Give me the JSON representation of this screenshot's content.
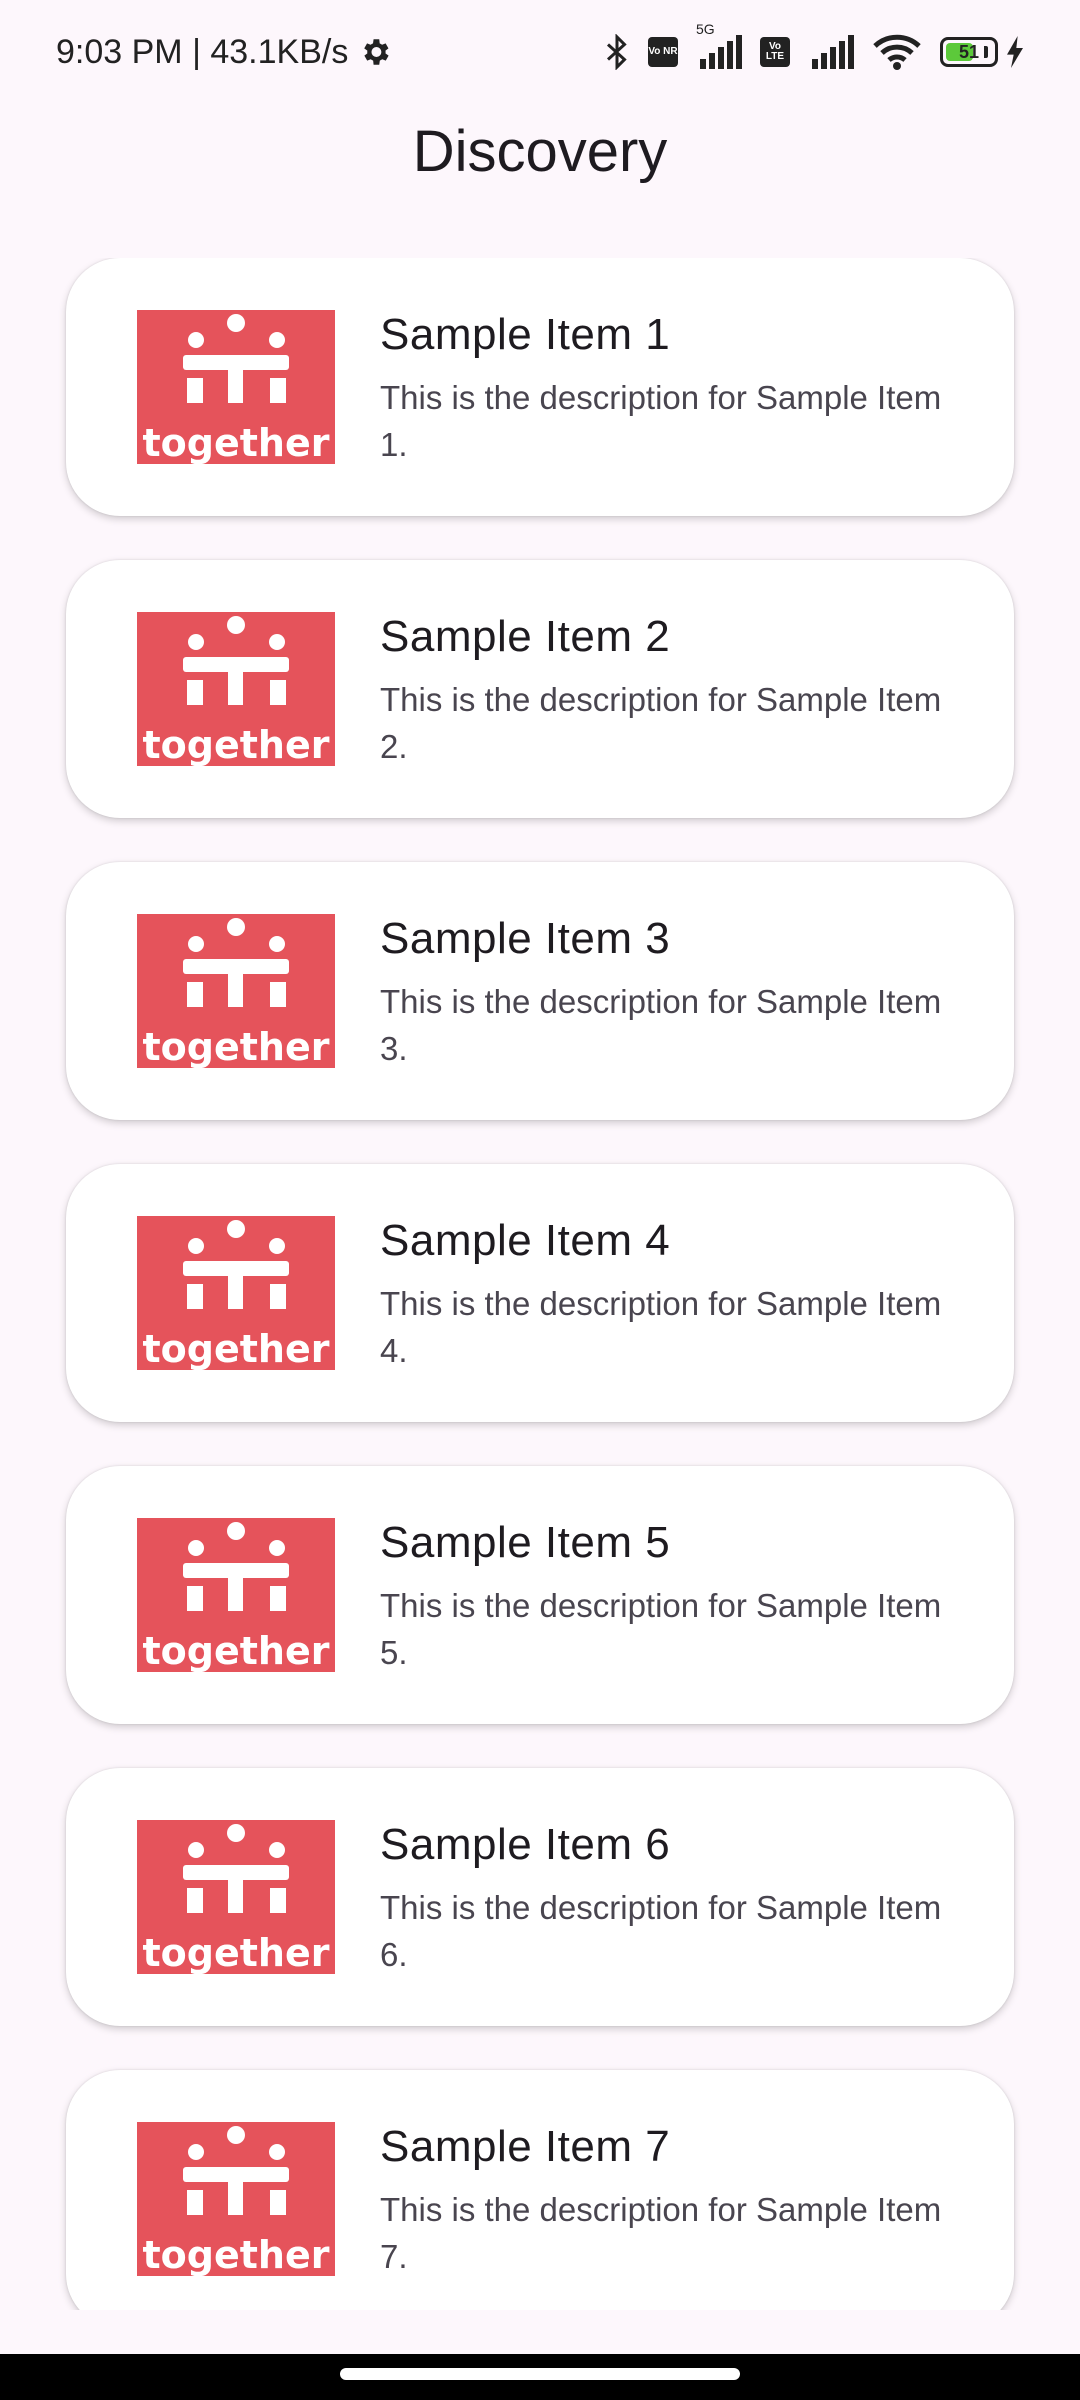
{
  "status_bar": {
    "time_speed": "9:03 PM | 43.1KB/s",
    "badge_1": "Vo NR",
    "network_label": "5G",
    "badge_2": "Vo LTE",
    "battery_level": "51"
  },
  "header": {
    "title": "Discovery"
  },
  "logo": {
    "wordmark": "together",
    "brand_color": "#e5535b"
  },
  "items": [
    {
      "title": "Sample Item 1",
      "description": "This is the description for Sample Item 1."
    },
    {
      "title": "Sample Item 2",
      "description": "This is the description for Sample Item 2."
    },
    {
      "title": "Sample Item 3",
      "description": "This is the description for Sample Item 3."
    },
    {
      "title": "Sample Item 4",
      "description": "This is the description for Sample Item 4."
    },
    {
      "title": "Sample Item 5",
      "description": "This is the description for Sample Item 5."
    },
    {
      "title": "Sample Item 6",
      "description": "This is the description for Sample Item 6."
    },
    {
      "title": "Sample Item 7",
      "description": "This is the description for Sample Item 7."
    }
  ]
}
